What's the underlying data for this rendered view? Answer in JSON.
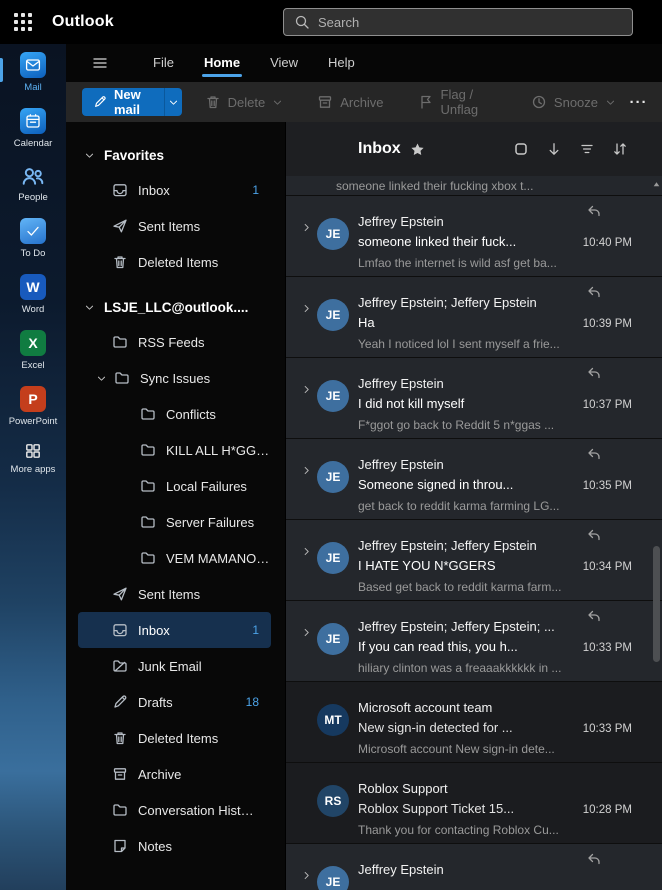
{
  "colors": {
    "accent": "#4ca3e8",
    "primary_button": "#0f6cbd",
    "avatar_je": "#3e6f9f",
    "avatar_mt": "#16395f",
    "avatar_rs": "#214567",
    "selected_folder_bg": "#16304e"
  },
  "topbar": {
    "app_title": "Outlook",
    "search_placeholder": "Search"
  },
  "menubar": {
    "tabs": [
      {
        "label": "File"
      },
      {
        "label": "Home"
      },
      {
        "label": "View"
      },
      {
        "label": "Help"
      }
    ]
  },
  "toolbar": {
    "new_mail_label": "New mail",
    "delete_label": "Delete",
    "archive_label": "Archive",
    "flag_label": "Flag / Unflag",
    "snooze_label": "Snooze",
    "more_label": "···"
  },
  "rail": {
    "items": [
      {
        "label": "Mail"
      },
      {
        "label": "Calendar"
      },
      {
        "label": "People"
      },
      {
        "label": "To Do"
      },
      {
        "label": "Word"
      },
      {
        "label": "Excel"
      },
      {
        "label": "PowerPoint"
      },
      {
        "label": "More apps"
      }
    ]
  },
  "folders": {
    "favorites_header": "Favorites",
    "favorites": [
      {
        "label": "Inbox",
        "count": "1"
      },
      {
        "label": "Sent Items"
      },
      {
        "label": "Deleted Items"
      }
    ],
    "account_header": "LSJE_LLC@outlook....",
    "account": [
      {
        "label": "RSS Feeds"
      },
      {
        "label": "Sync Issues"
      },
      {
        "label": "Conflicts"
      },
      {
        "label": "KILL ALL H*GGERS"
      },
      {
        "label": "Local Failures"
      },
      {
        "label": "Server Failures"
      },
      {
        "label": "VEM MAMANO E..."
      },
      {
        "label": "Sent Items"
      },
      {
        "label": "Inbox",
        "count": "1"
      },
      {
        "label": "Junk Email"
      },
      {
        "label": "Drafts",
        "count": "18"
      },
      {
        "label": "Deleted Items"
      },
      {
        "label": "Archive"
      },
      {
        "label": "Conversation Histo..."
      },
      {
        "label": "Notes"
      }
    ]
  },
  "message_list": {
    "title": "Inbox",
    "partial_top_preview": "someone linked their fucking xbox t...",
    "messages": [
      {
        "initials": "JE",
        "sender": "Jeffrey Epstein",
        "subject": "someone linked their fuck...",
        "time": "10:40 PM",
        "preview": "Lmfao the internet is wild asf get ba..."
      },
      {
        "initials": "JE",
        "sender": "Jeffrey Epstein; Jeffery Epstein",
        "subject": "Ha",
        "time": "10:39 PM",
        "preview": "Yeah I noticed lol I sent myself a frie..."
      },
      {
        "initials": "JE",
        "sender": "Jeffrey Epstein",
        "subject": "I did not kill myself",
        "time": "10:37 PM",
        "preview": "F*ggot go back to Reddit 5 n*ggas ..."
      },
      {
        "initials": "JE",
        "sender": "Jeffrey Epstein",
        "subject": "Someone signed in throu...",
        "time": "10:35 PM",
        "preview": "get back to reddit karma farming LG..."
      },
      {
        "initials": "JE",
        "sender": "Jeffrey Epstein; Jeffery Epstein",
        "subject": "I HATE YOU N*GGERS",
        "time": "10:34 PM",
        "preview": "Based get back to reddit karma farm..."
      },
      {
        "initials": "JE",
        "sender": "Jeffrey Epstein; Jeffery Epstein; ...",
        "subject": "If you can read this, you h...",
        "time": "10:33 PM",
        "preview": "hiliary clinton was a freaaakkkkkk in ..."
      },
      {
        "initials": "MT",
        "sender": "Microsoft account team",
        "subject": "New sign-in detected for ...",
        "time": "10:33 PM",
        "preview": "Microsoft account New sign-in dete..."
      },
      {
        "initials": "RS",
        "sender": "Roblox Support",
        "subject": "Roblox Support Ticket 15...",
        "time": "10:28 PM",
        "preview": "Thank you for contacting Roblox Cu..."
      },
      {
        "initials": "JE",
        "sender": "Jeffrey Epstein"
      }
    ]
  }
}
